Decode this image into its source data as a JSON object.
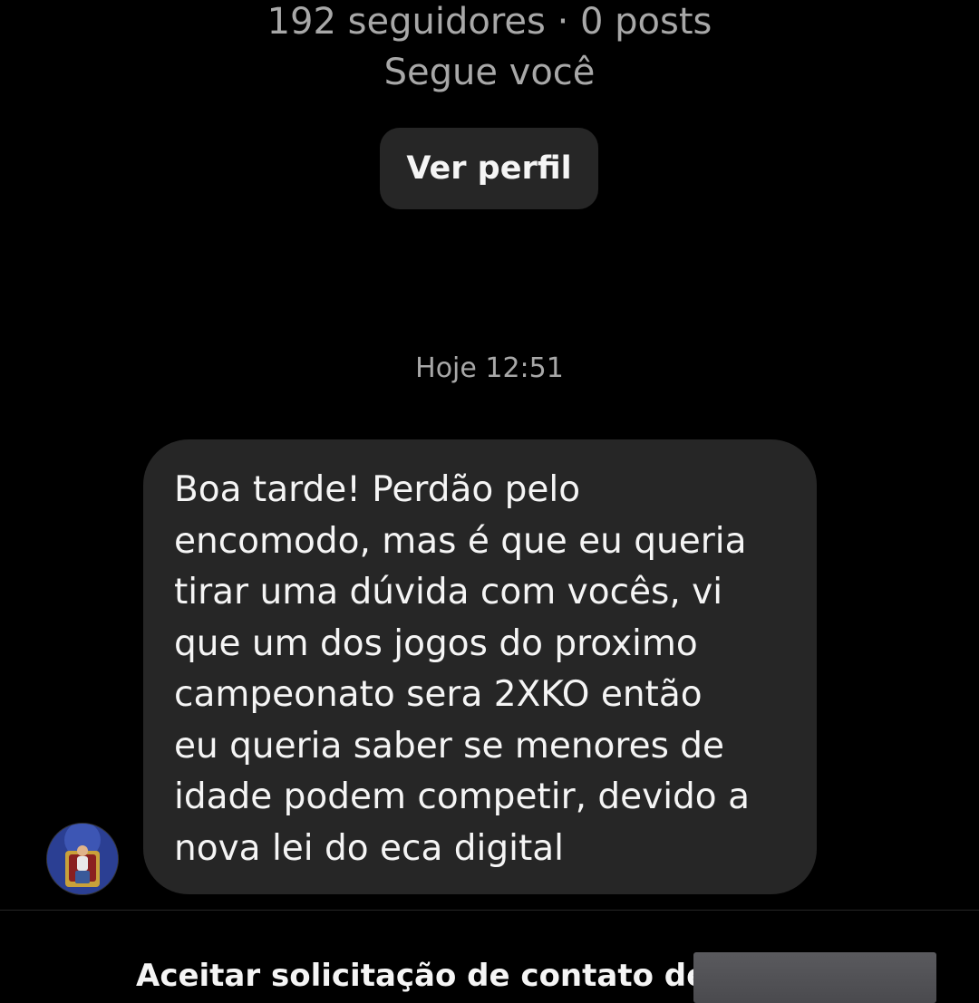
{
  "profile": {
    "stats": "192 seguidores · 0 posts",
    "follows_you": "Segue você",
    "view_profile_label": "Ver perfil"
  },
  "chat": {
    "timestamp": "Hoje 12:51",
    "message": {
      "lines": [
        "Boa tarde! Perdão pelo",
        "encomodo, mas é que eu queria",
        "tirar uma dúvida com vocês, vi",
        "que um dos jogos do proximo",
        "campeonato sera 2XKO então",
        "eu queria saber se menores de",
        "idade podem competir, devido a",
        "nova lei do eca digital"
      ]
    }
  },
  "request_bar": {
    "accept_text": "Aceitar solicitação de contato de"
  },
  "colors": {
    "background": "#000000",
    "bubble": "#262626",
    "secondary_text": "#a8a8a8",
    "primary_text": "#f5f5f5"
  }
}
